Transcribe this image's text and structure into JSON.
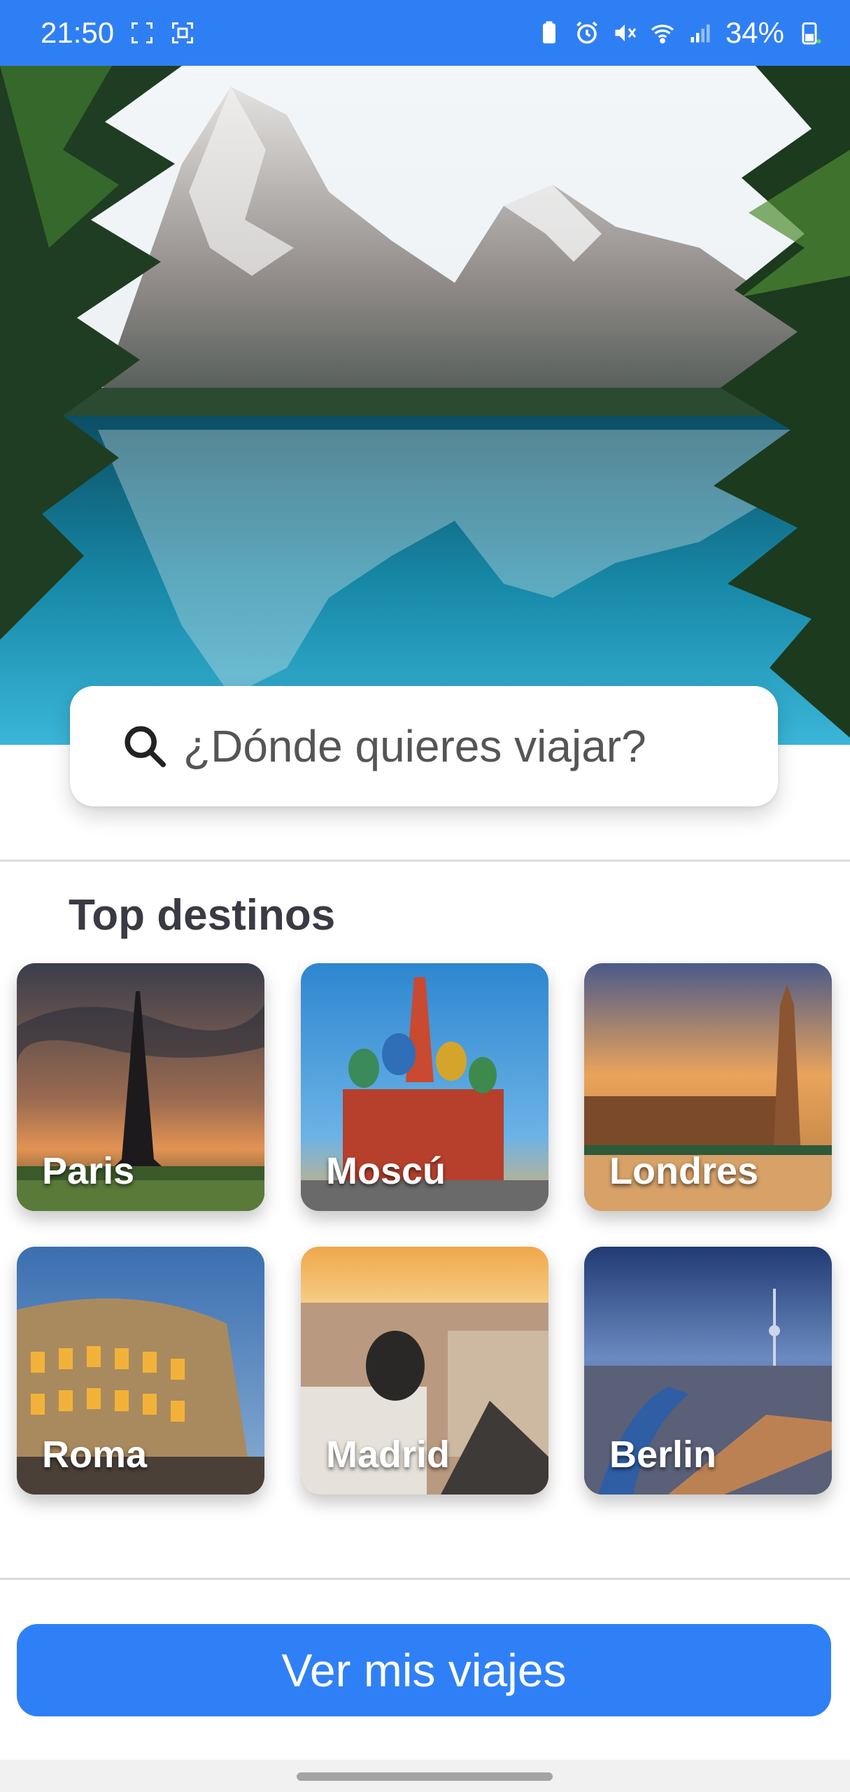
{
  "status_bar": {
    "time": "21:50",
    "battery": "34%",
    "icons": [
      "screenshot-icon",
      "scan-icon",
      "battery-saver-icon",
      "alarm-icon",
      "mute-icon",
      "wifi-icon",
      "signal-icon",
      "battery-icon"
    ]
  },
  "hero": {
    "image": "mountain-lake-image"
  },
  "search": {
    "placeholder": "¿Dónde quieres viajar?"
  },
  "top_destinations": {
    "title": "Top destinos",
    "cards": [
      {
        "label": "Paris",
        "image": "eiffel-tower"
      },
      {
        "label": "Moscú",
        "image": "saint-basils-cathedral"
      },
      {
        "label": "Londres",
        "image": "big-ben"
      },
      {
        "label": "Roma",
        "image": "colosseum"
      },
      {
        "label": "Madrid",
        "image": "metropolis-building"
      },
      {
        "label": "Berlin",
        "image": "tv-tower"
      }
    ]
  },
  "cta": {
    "label": "Ver mis viajes"
  },
  "colors": {
    "primary": "#2f80f7",
    "status_bar": "#2f7ff4",
    "title_text": "#3a3a44"
  }
}
